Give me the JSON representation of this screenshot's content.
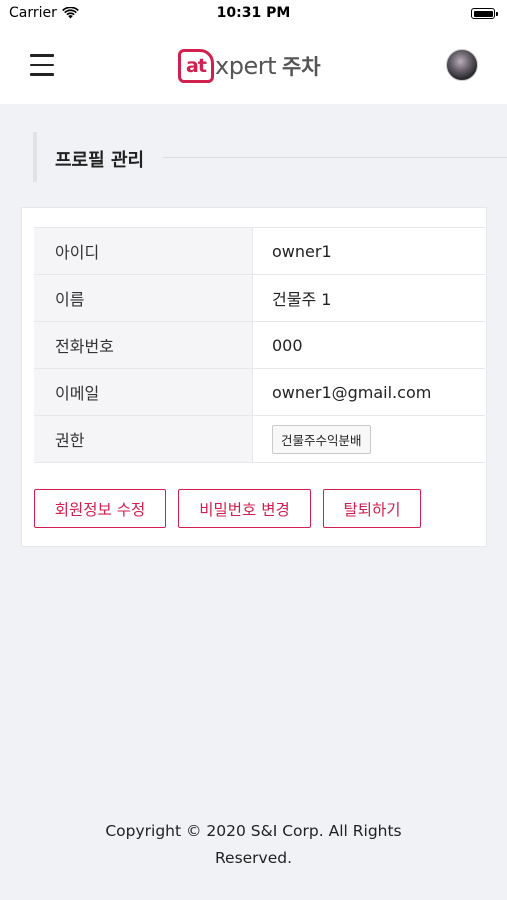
{
  "status_bar": {
    "carrier": "Carrier",
    "time": "10:31 PM"
  },
  "header": {
    "logo_at": "at",
    "logo_xpert": "xpert",
    "logo_service": "주차",
    "brand_color": "#d11f4f"
  },
  "section": {
    "title": "프로필 관리"
  },
  "profile": {
    "rows": [
      {
        "label": "아이디",
        "value": "owner1"
      },
      {
        "label": "이름",
        "value": "건물주 1"
      },
      {
        "label": "전화번호",
        "value": "000"
      },
      {
        "label": "이메일",
        "value": "owner1@gmail.com"
      },
      {
        "label": "권한",
        "value": "건물주수익분배"
      }
    ]
  },
  "actions": {
    "edit_label": "회원정보 수정",
    "password_label": "비밀번호 변경",
    "withdraw_label": "탈퇴하기"
  },
  "footer": {
    "line1": "Copyright © 2020 S&I Corp. All Rights",
    "line2": "Reserved."
  },
  "icons": {
    "menu": "hamburger-menu-icon",
    "wifi": "wifi-icon",
    "battery": "battery-icon",
    "avatar": "user-avatar"
  }
}
